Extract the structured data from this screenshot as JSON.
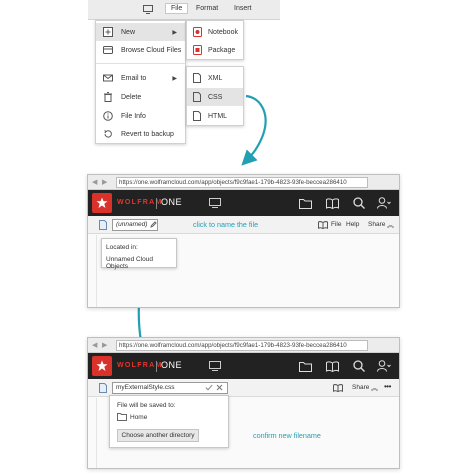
{
  "menubar": {
    "items": [
      "File",
      "Format",
      "Insert"
    ],
    "active": "File"
  },
  "file_menu": {
    "items": [
      {
        "label": "New",
        "icon": "new-document-icon",
        "submenu": true
      },
      {
        "label": "Browse Cloud Files",
        "icon": "cloud-icon"
      },
      {
        "label": "Email to",
        "icon": "envelope-icon",
        "submenu": true
      },
      {
        "label": "Delete",
        "icon": "trash-icon"
      },
      {
        "label": "File Info",
        "icon": "info-icon"
      },
      {
        "label": "Revert to backup",
        "icon": "revert-icon"
      }
    ]
  },
  "new_submenu": {
    "items": [
      {
        "label": "Notebook",
        "icon": "notebook-icon"
      },
      {
        "label": "Package",
        "icon": "package-icon"
      }
    ]
  },
  "filetype_submenu": {
    "items": [
      {
        "label": "XML",
        "icon": "file-icon"
      },
      {
        "label": "CSS",
        "icon": "file-icon"
      },
      {
        "label": "HTML",
        "icon": "file-icon"
      }
    ]
  },
  "window1": {
    "url": "https://one.wolframcloud.com/app/objects/f9c9fae1-179b-4823-93fe-beccea286410",
    "brand_red": "WOLFRAM",
    "brand_white": "ONE",
    "filename": "(unnamed)",
    "toolbar_file": "File",
    "toolbar_help": "Help",
    "toolbar_share": "Share",
    "popup_title": "Located in:",
    "popup_location": "Unnamed Cloud Objects"
  },
  "window2": {
    "url": "https://one.wolframcloud.com/app/objects/f9c9fae1-179b-4823-93fe-beccea286410",
    "brand_red": "WOLFRAM",
    "brand_white": "ONE",
    "filename": "myExternalStyle.css",
    "toolbar_share": "Share",
    "popup_title": "File will be saved to:",
    "popup_folder": "Home",
    "popup_button": "Choose another directory"
  },
  "callouts": {
    "name_file": "click to name the file",
    "confirm": "confirm new filename"
  },
  "colors": {
    "accent_teal": "#22a0b3",
    "wolfram_red": "#d9322b",
    "toolbar_dark": "#222222"
  }
}
